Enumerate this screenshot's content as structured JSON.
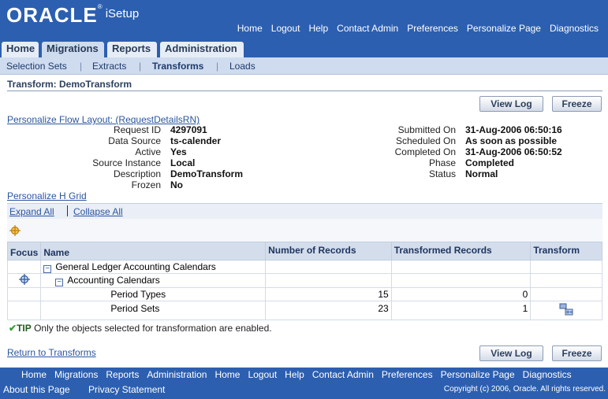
{
  "brand": {
    "oracle": "ORACLE",
    "reg": "®",
    "product": "iSetup"
  },
  "global_links": [
    "Home",
    "Logout",
    "Help",
    "Contact Admin",
    "Preferences",
    "Personalize Page",
    "Diagnostics"
  ],
  "tabs": [
    {
      "label": "Home",
      "active": false
    },
    {
      "label": "Migrations",
      "active": true
    },
    {
      "label": "Reports",
      "active": false
    },
    {
      "label": "Administration",
      "active": false
    }
  ],
  "subtabs": [
    {
      "label": "Selection Sets",
      "active": false
    },
    {
      "label": "Extracts",
      "active": false
    },
    {
      "label": "Transforms",
      "active": true
    },
    {
      "label": "Loads",
      "active": false
    }
  ],
  "subtab_separator": "|",
  "page_title": "Transform: DemoTransform",
  "buttons": {
    "view_log": "View Log",
    "freeze": "Freeze"
  },
  "personalize_flow": "Personalize Flow Layout: (RequestDetailsRN)",
  "details_left": [
    {
      "label": "Request ID",
      "value": "4297091"
    },
    {
      "label": "Data Source",
      "value": "ts-calender"
    },
    {
      "label": "Active",
      "value": "Yes"
    },
    {
      "label": "Source Instance",
      "value": "Local"
    },
    {
      "label": "Description",
      "value": "DemoTransform"
    },
    {
      "label": "Frozen",
      "value": "No"
    }
  ],
  "details_right": [
    {
      "label": "Submitted On",
      "value": "31-Aug-2006 06:50:16"
    },
    {
      "label": "Scheduled On",
      "value": "As soon as possible"
    },
    {
      "label": "Completed On",
      "value": "31-Aug-2006 06:50:52"
    },
    {
      "label": "Phase",
      "value": "Completed"
    },
    {
      "label": "Status",
      "value": "Normal"
    }
  ],
  "personalize_hgrid": "Personalize H Grid",
  "expand_all": "Expand All",
  "collapse_all": "Collapse All",
  "grid": {
    "headers": {
      "focus": "Focus",
      "name": "Name",
      "records": "Number of Records",
      "transformed": "Transformed Records",
      "transform": "Transform"
    },
    "rows": [
      {
        "name": "General Ledger Accounting Calendars",
        "toggle": "−",
        "records": "",
        "transformed": ""
      },
      {
        "name": "Accounting Calendars",
        "toggle": "−",
        "records": "",
        "transformed": ""
      },
      {
        "name": "Period Types",
        "records": "15",
        "transformed": "0"
      },
      {
        "name": "Period Sets",
        "records": "23",
        "transformed": "1"
      }
    ]
  },
  "tip": {
    "prefix": "TIP",
    "text": "Only the objects selected for transformation are enabled."
  },
  "return_link": "Return to Transforms",
  "footer": {
    "links": [
      "Home",
      "Migrations",
      "Reports",
      "Administration",
      "Home",
      "Logout",
      "Help",
      "Contact Admin",
      "Preferences",
      "Personalize Page",
      "Diagnostics"
    ],
    "about": "About this Page",
    "privacy": "Privacy Statement",
    "copyright": "Copyright (c) 2006, Oracle. All rights reserved."
  },
  "colors": {
    "brand_blue": "#2c5fb0",
    "subtab_bg": "#cfdbee",
    "link": "#2a55a0"
  }
}
